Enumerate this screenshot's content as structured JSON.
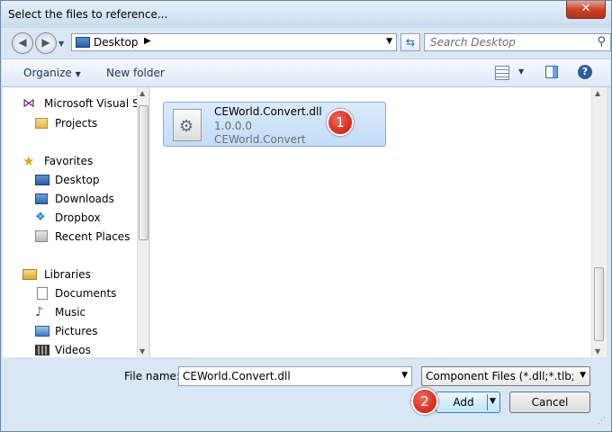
{
  "window": {
    "title": "Select the files to reference..."
  },
  "address": {
    "location": "Desktop",
    "search_placeholder": "Search Desktop"
  },
  "toolbar": {
    "organize": "Organize",
    "new_folder": "New folder"
  },
  "nav": {
    "items": [
      {
        "label": "Microsoft Visual St",
        "icon": "visual-studio-icon",
        "level": "top"
      },
      {
        "label": "Projects",
        "icon": "folder-icon",
        "level": "child"
      },
      {
        "label": "Favorites",
        "icon": "star-icon",
        "level": "top"
      },
      {
        "label": "Desktop",
        "icon": "desktop-icon",
        "level": "child"
      },
      {
        "label": "Downloads",
        "icon": "downloads-icon",
        "level": "child"
      },
      {
        "label": "Dropbox",
        "icon": "dropbox-icon",
        "level": "child"
      },
      {
        "label": "Recent Places",
        "icon": "recent-places-icon",
        "level": "child"
      },
      {
        "label": "Libraries",
        "icon": "libraries-icon",
        "level": "top"
      },
      {
        "label": "Documents",
        "icon": "documents-icon",
        "level": "child"
      },
      {
        "label": "Music",
        "icon": "music-icon",
        "level": "child"
      },
      {
        "label": "Pictures",
        "icon": "pictures-icon",
        "level": "child"
      },
      {
        "label": "Videos",
        "icon": "videos-icon",
        "level": "child"
      }
    ]
  },
  "files": [
    {
      "name": "CEWorld.Convert.dll",
      "version": "1.0.0.0",
      "description": "CEWorld.Convert",
      "icon": "dll-gear-icon"
    }
  ],
  "annotations": {
    "badge1": "1",
    "badge2": "2"
  },
  "bottom": {
    "file_name_label": "File name:",
    "file_name_value": "CEWorld.Convert.dll",
    "file_type_value": "Component Files (*.dll;*.tlb;*.ol",
    "add_label": "Add",
    "cancel_label": "Cancel"
  },
  "colors": {
    "accent": "#3c7fb1",
    "selection": "#c3dcf8",
    "badge": "#d6281b",
    "close": "#c9442a"
  }
}
